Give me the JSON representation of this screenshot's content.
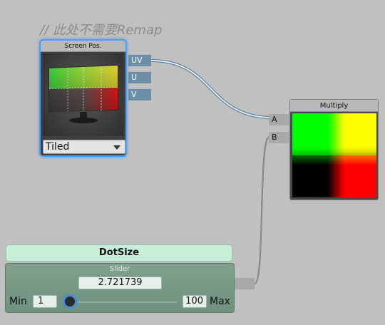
{
  "comment": "// 此处不需要Remap",
  "screen_pos_node": {
    "title": "Screen Pos.",
    "outputs": [
      "UV",
      "U",
      "V"
    ],
    "mode": "Tiled"
  },
  "multiply_node": {
    "title": "Multiply",
    "inputs": [
      "A",
      "B"
    ]
  },
  "dotsize_property": {
    "name": "DotSize",
    "type_label": "Slider",
    "value": "2.721739",
    "min_label": "Min",
    "min": "1",
    "max_label": "Max",
    "max": "100",
    "slider_level": 0.0
  },
  "colors": {
    "canvas": "#c0c0c0",
    "selection": "#4aa0f0",
    "port_vector": "#6c8ea7",
    "property_header": "#c6eed9",
    "property_body": "#7ea08d"
  }
}
